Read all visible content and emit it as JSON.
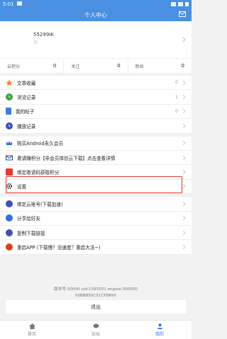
{
  "status_bar": {
    "time": "5:01"
  },
  "header": {
    "title": "个人中心"
  },
  "profile": {
    "username": "55299IK"
  },
  "stats": [
    {
      "label": "云积分",
      "value": "0"
    },
    {
      "label": "关注",
      "value": "0"
    },
    {
      "label": "粉丝",
      "value": "0"
    }
  ],
  "menu": {
    "items": [
      {
        "label": "文章收藏",
        "count": "0",
        "icon": "star-icon"
      },
      {
        "label": "浏览记录",
        "count": "1",
        "icon": "history-icon"
      },
      {
        "label": "我的帖子",
        "count": "0",
        "icon": "document-icon"
      },
      {
        "label": "播放记录",
        "count": "",
        "icon": "clock-icon"
      },
      {
        "label": "购买Android永久会员",
        "count": "",
        "icon": "crown-icon"
      },
      {
        "label": "邀请赚积分【非会员体验云下载】点击查看详情",
        "count": "",
        "icon": "mail-icon"
      },
      {
        "label": "绑定邀请码获取积分",
        "count": "",
        "icon": "gift-icon"
      },
      {
        "label": "设置",
        "count": "",
        "icon": "gear-icon"
      },
      {
        "label": "绑定云账号(下载加速)",
        "count": "",
        "icon": "cloud-icon"
      },
      {
        "label": "分享给好友",
        "count": "",
        "icon": "share-icon"
      },
      {
        "label": "复制下载链接",
        "count": "",
        "icon": "link-icon"
      },
      {
        "label": "重启APP (下载慢？没速度？重启大法~)",
        "count": "",
        "icon": "power-icon"
      }
    ]
  },
  "version": {
    "line1": "版本号:30000 uid:1593501 engine:300000",
    "line2": "00BB850C51CF889X"
  },
  "logout_label": "退出",
  "bottom_nav": [
    {
      "label": "首页",
      "icon": "home-icon"
    },
    {
      "label": "论坛",
      "icon": "forum-icon"
    },
    {
      "label": "我的",
      "icon": "person-icon"
    }
  ],
  "colors": {
    "accent": "#4a90e2",
    "nav_active": "#2f6fe0",
    "highlight": "#e53935"
  }
}
